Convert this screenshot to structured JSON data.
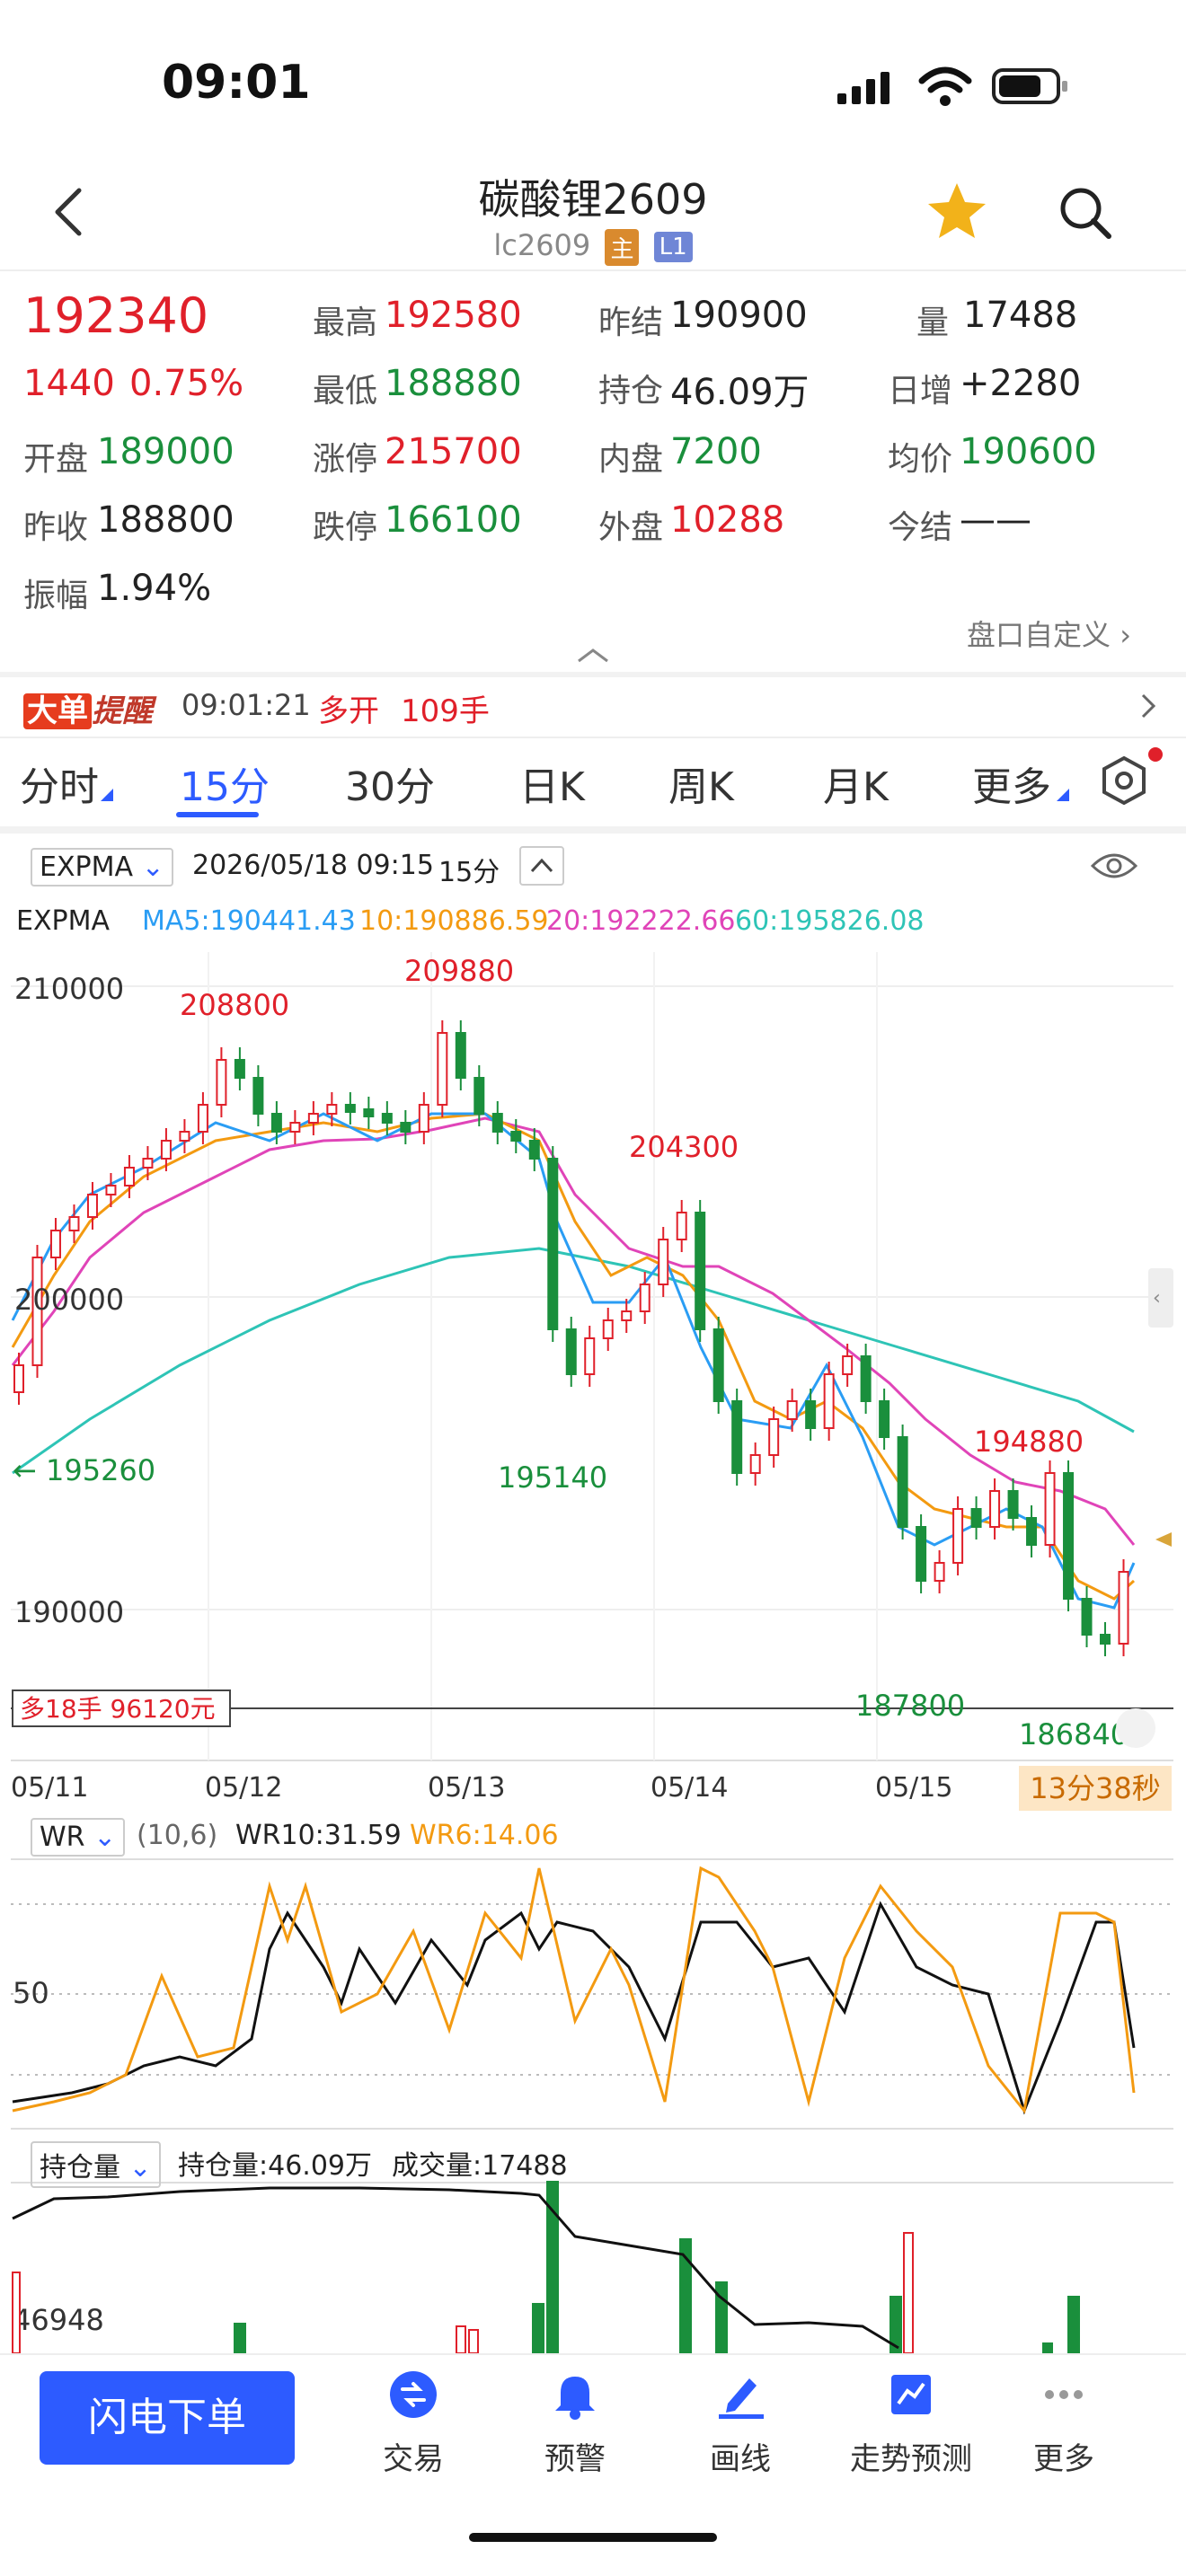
{
  "status_bar": {
    "time": "09:01"
  },
  "header": {
    "title": "碳酸锂2609",
    "code": "lc2609",
    "tag_main": "主",
    "tag_level": "L1"
  },
  "quote": {
    "last": "192340",
    "change": "1440",
    "change_pct": "0.75%",
    "high_label": "最高",
    "high": "192580",
    "low_label": "最低",
    "low": "188880",
    "open_label": "开盘",
    "open": "189000",
    "prev_close_label": "昨收",
    "prev_close": "188800",
    "amplitude_label": "振幅",
    "amplitude": "1.94%",
    "limit_up_label": "涨停",
    "limit_up": "215700",
    "limit_down_label": "跌停",
    "limit_down": "166100",
    "prev_settle_label": "昨结",
    "prev_settle": "190900",
    "open_interest_label": "持仓",
    "open_interest": "46.09万",
    "inner_label": "内盘",
    "inner": "7200",
    "outer_label": "外盘",
    "outer": "10288",
    "volume_label": "量",
    "volume": "17488",
    "daily_inc_label": "日增",
    "daily_inc": "+2280",
    "avg_label": "均价",
    "avg": "190600",
    "settle_label": "今结",
    "settle": "——",
    "custom_label": "盘口自定义"
  },
  "alert": {
    "brand_a": "大单",
    "brand_b": "提醒",
    "time": "09:01:21",
    "action": "多开",
    "qty": "109手"
  },
  "tabs": [
    "分时",
    "15分",
    "30分",
    "日K",
    "周K",
    "月K",
    "更多"
  ],
  "active_tab": "15分",
  "kline": {
    "indicator": "EXPMA",
    "datetime": "2026/05/18 09:15",
    "period": "15分",
    "legend_name": "EXPMA",
    "ma5": "MA5:190441.43",
    "ma10": "10:190886.59",
    "ma20": "20:192222.66",
    "ma60": "60:195826.08",
    "y_ticks": [
      "210000",
      "200000",
      "190000"
    ],
    "x_ticks": [
      "05/11",
      "05/12",
      "05/13",
      "05/14",
      "05/15"
    ],
    "peak_labels": {
      "p1": "208800",
      "p2": "209880",
      "p3": "204300",
      "p4": "194880"
    },
    "trough_labels": {
      "t1": "195260",
      "t2": "195140",
      "t3": "187800",
      "t4": "186840"
    },
    "position_tag": "多18手 96120元",
    "countdown": "13分38秒",
    "colors": {
      "ma5": "#2a9df4",
      "ma10": "#f39a11",
      "ma20": "#e044b8",
      "ma60": "#2ec4b6",
      "up": "#e0202a",
      "down": "#1a8f3c"
    }
  },
  "wr": {
    "name": "WR",
    "params": "(10,6)",
    "wr10": "WR10:31.59",
    "wr6": "WR6:14.06",
    "tick": "50"
  },
  "oi": {
    "name": "持仓量",
    "oi_label": "持仓量:46.09万",
    "vol_label": "成交量:17488",
    "tick": "46948"
  },
  "bottom": {
    "flash": "闪电下单",
    "items": [
      "交易",
      "预警",
      "画线",
      "走势预测",
      "更多"
    ]
  }
}
